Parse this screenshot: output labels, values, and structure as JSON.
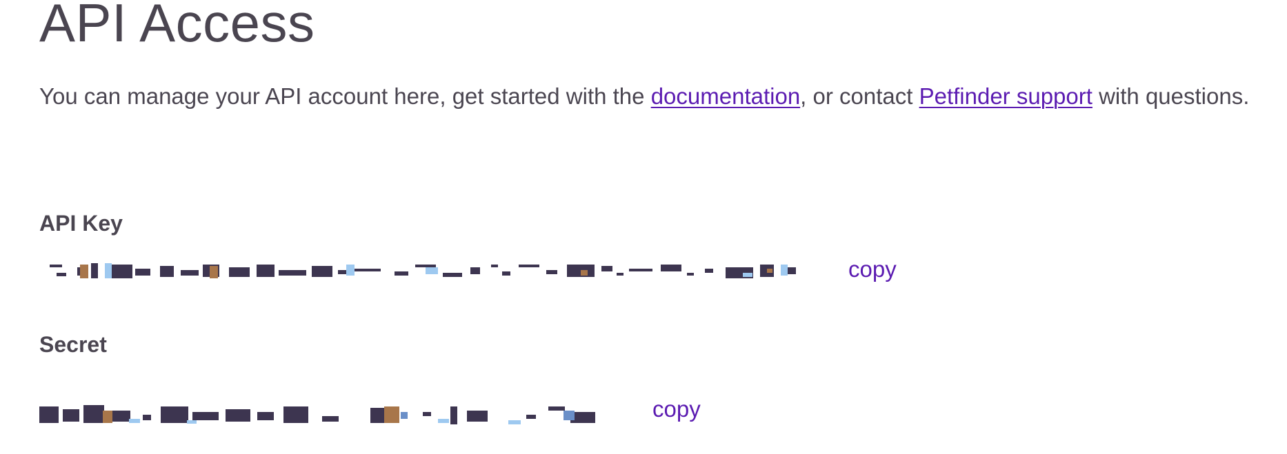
{
  "page": {
    "title": "API Access"
  },
  "intro": {
    "prefix": "You can manage your API account here, get started with the ",
    "documentation_link": "documentation",
    "middle": ", or contact ",
    "support_link": "Petfinder support",
    "suffix": " with questions."
  },
  "api_key": {
    "label": "API Key",
    "copy_label": "copy"
  },
  "secret": {
    "label": "Secret",
    "copy_label": "copy"
  },
  "colors": {
    "text": "#4a4550",
    "link": "#5b1bb1",
    "redaction_dark": "#3d3550",
    "redaction_brown": "#a8764a",
    "redaction_blue": "#9ec9f0",
    "redaction_steel": "#6a8fc8"
  }
}
